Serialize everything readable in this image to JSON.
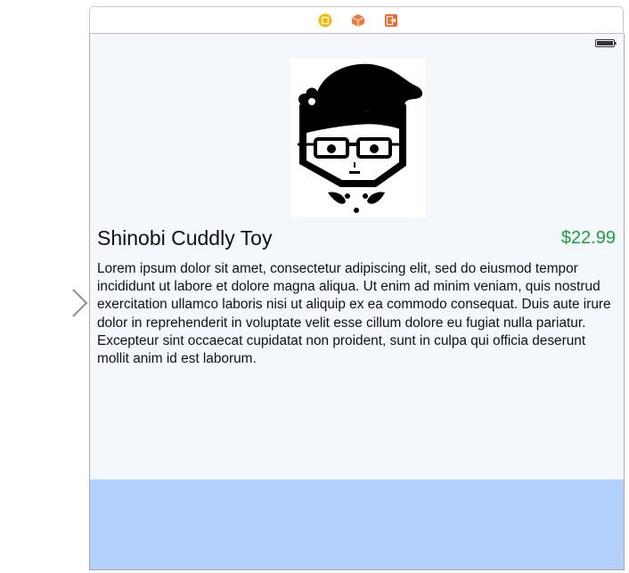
{
  "scene": {
    "icons": [
      "view-controller-icon",
      "first-responder-icon",
      "exit-icon"
    ]
  },
  "status_bar": {
    "icon": "battery-icon"
  },
  "product": {
    "title": "Shinobi Cuddly Toy",
    "price": "$22.99",
    "description": "Lorem ipsum dolor sit amet, consectetur adipiscing elit, sed do eiusmod tempor incididunt ut labore et dolore magna aliqua. Ut enim ad minim veniam, quis nostrud exercitation ullamco laboris nisi ut aliquip ex ea commodo consequat. Duis aute irure dolor in reprehenderit in voluptate velit esse cillum dolore eu fugiat nulla pariatur. Excepteur sint occaecat cupidatat non proident, sunt in culpa qui officia deserunt mollit anim id est laborum.",
    "image": "ninja-girl-portrait"
  },
  "colors": {
    "price": "#1e9e3c",
    "view_background": "#f4f7fb",
    "bottom_panel": "#b3cffb",
    "view_controller_icon": "#f5b800",
    "first_responder_icon": "#f07a3a",
    "exit_icon": "#ee6a2c"
  },
  "entry_point": {
    "icon": "storyboard-entry-arrow"
  }
}
